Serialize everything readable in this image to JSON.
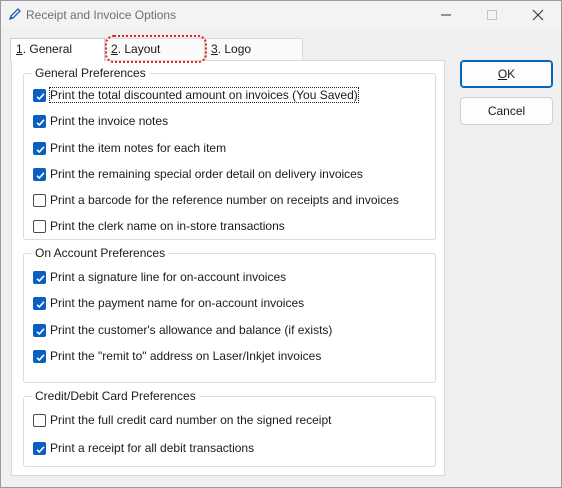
{
  "window": {
    "title": "Receipt and Invoice Options",
    "accent_color": "#0067c0",
    "checkbox_color": "#0a5fc0",
    "focus_highlight_color": "#e3261c"
  },
  "tabs": [
    {
      "mnemonic": "1",
      "label": ". General",
      "active": true
    },
    {
      "mnemonic": "2",
      "label": ". Layout",
      "active": false,
      "highlighted": true
    },
    {
      "mnemonic": "3",
      "label": ". Logo",
      "active": false
    }
  ],
  "groups": [
    {
      "title": "General Preferences",
      "items": [
        {
          "label": "Print the total discounted amount on invoices (You Saved)",
          "checked": true,
          "focused": true
        },
        {
          "label": "Print the invoice notes",
          "checked": true
        },
        {
          "label": "Print the item notes for each item",
          "checked": true
        },
        {
          "label": "Print the remaining special order detail on delivery invoices",
          "checked": true
        },
        {
          "label": "Print a barcode for the reference number on receipts and invoices",
          "checked": false
        },
        {
          "label": "Print the clerk name on in-store transactions",
          "checked": false
        }
      ]
    },
    {
      "title": "On Account Preferences",
      "items": [
        {
          "label": "Print a signature line for on-account invoices",
          "checked": true
        },
        {
          "label": "Print the payment name for on-account invoices",
          "checked": true
        },
        {
          "label": "Print the customer's allowance and balance (if exists)",
          "checked": true
        },
        {
          "label": "Print the \"remit to\" address on Laser/Inkjet invoices",
          "checked": true
        }
      ]
    },
    {
      "title": "Credit/Debit Card Preferences",
      "items": [
        {
          "label": "Print the full credit card number on the signed receipt",
          "checked": false
        },
        {
          "label": "Print a receipt for all debit transactions",
          "checked": true
        }
      ]
    }
  ],
  "buttons": {
    "ok": {
      "mnemonic": "O",
      "rest": "K"
    },
    "cancel": "Cancel"
  },
  "icons": {
    "app": "pencil-icon",
    "minimize": "minimize-icon",
    "maximize": "maximize-icon",
    "close": "close-icon",
    "check": "checkmark-icon"
  }
}
